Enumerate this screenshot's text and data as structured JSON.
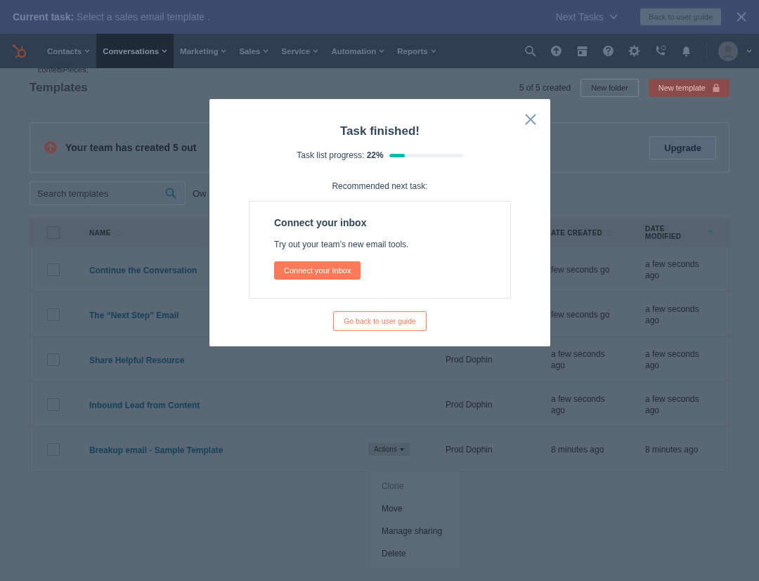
{
  "task_bar": {
    "label": "Current task:",
    "task": "Select a sales email template .",
    "next_tasks": "Next Tasks",
    "back_button": "Back to user guide"
  },
  "nav": {
    "items": [
      {
        "label": "Contacts",
        "selected": false
      },
      {
        "label": "Conversations",
        "selected": true
      },
      {
        "label": "Marketing",
        "selected": false
      },
      {
        "label": "Sales",
        "selected": false
      },
      {
        "label": "Service",
        "selected": false
      },
      {
        "label": "Automation",
        "selected": false
      },
      {
        "label": "Reports",
        "selected": false
      }
    ]
  },
  "header": {
    "code_fragment": "confettiPieces;",
    "title": "Templates",
    "count": "5 of 5 created",
    "new_folder": "New folder",
    "new_template": "New template"
  },
  "banner": {
    "text": "Your team has created 5 out",
    "button": "Upgrade"
  },
  "search": {
    "placeholder": "Search templates"
  },
  "owner_filter": "Ow",
  "table": {
    "select_all_checked": false,
    "columns": [
      {
        "label": "NAME",
        "sorted": false
      },
      {
        "label": "ATE CREATED",
        "sorted": false
      },
      {
        "label": "DATE MODIFIED",
        "sorted": true
      }
    ],
    "rows": [
      {
        "name": "Continue the Conversation",
        "checked": false,
        "created": "few seconds go",
        "modified": "a few seconds ago"
      },
      {
        "name": "The “Next Step” Email",
        "checked": false,
        "created": "few seconds go",
        "modified": "a few seconds ago"
      },
      {
        "name": "Share Helpful Resource",
        "checked": false,
        "owner": "Prod Dophin",
        "created": "a few seconds ago",
        "modified": "a few seconds ago"
      },
      {
        "name": "Inbound Lead from Content",
        "checked": false,
        "owner": "Prod Dophin",
        "created": "a few seconds ago",
        "modified": "a few seconds ago"
      },
      {
        "name": "Breakup email - Sample Template",
        "checked": false,
        "actions": "Actions",
        "owner": "Prod Dophin",
        "created": "8 minutes ago",
        "modified": "8 minutes ago"
      }
    ]
  },
  "actions_menu": {
    "items": [
      {
        "label": "Clone",
        "disabled": true
      },
      {
        "label": "Move",
        "disabled": false
      },
      {
        "label": "Manage sharing",
        "disabled": false
      },
      {
        "label": "Delete",
        "disabled": false
      }
    ]
  },
  "modal": {
    "title": "Task finished!",
    "progress_label": "Task list progress:",
    "progress_value": "22%",
    "level": 0.21,
    "recommended": "Recommended next task:",
    "card": {
      "title": "Connect your inbox",
      "description": "Try out your team’s new email tools.",
      "button": "Connect your Inbox"
    },
    "secondary_button": "Go back to user guide"
  }
}
